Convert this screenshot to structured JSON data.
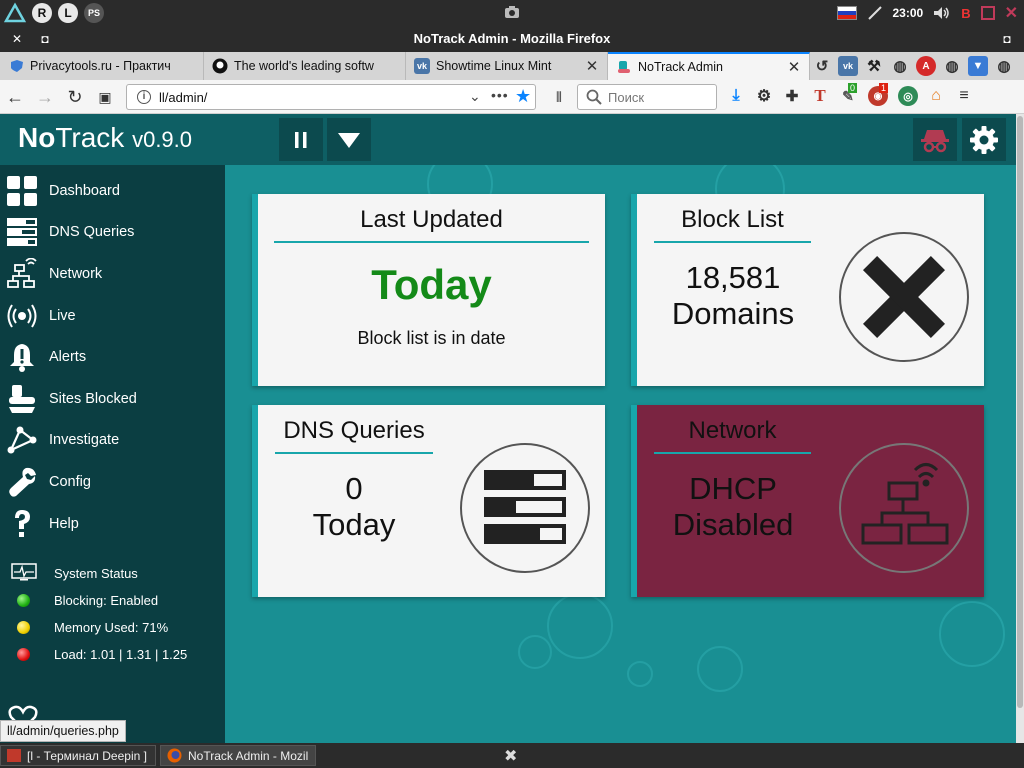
{
  "system_panel": {
    "launcher_letters": [
      "R",
      "L"
    ],
    "clock": "23:00"
  },
  "window": {
    "title": "NoTrack Admin - Mozilla Firefox"
  },
  "tabs": [
    {
      "label": "Privacytools.ru - Практич",
      "icon": "privacytools-shield-icon",
      "active": false
    },
    {
      "label": "The world's leading softw",
      "icon": "github-icon",
      "active": false
    },
    {
      "label": "Showtime Linux Mint",
      "icon": "vk-icon",
      "active": false
    },
    {
      "label": "NoTrack Admin",
      "icon": "notrack-icon",
      "active": true
    }
  ],
  "navbar": {
    "url": "ll/admin/",
    "search_placeholder": "Поиск",
    "badges": {
      "green": "0",
      "red": "1"
    }
  },
  "notrack": {
    "logo_bold": "No",
    "logo_rest": "Track",
    "version": "v0.9.0",
    "sidebar": [
      {
        "label": "Dashboard",
        "icon": "dashboard-icon"
      },
      {
        "label": "DNS Queries",
        "icon": "dns-queries-icon"
      },
      {
        "label": "Network",
        "icon": "network-icon"
      },
      {
        "label": "Live",
        "icon": "live-broadcast-icon"
      },
      {
        "label": "Alerts",
        "icon": "bell-icon"
      },
      {
        "label": "Sites Blocked",
        "icon": "sites-blocked-icon"
      },
      {
        "label": "Investigate",
        "icon": "investigate-icon"
      },
      {
        "label": "Config",
        "icon": "wrench-icon"
      },
      {
        "label": "Help",
        "icon": "question-icon"
      }
    ],
    "status": {
      "title": "System Status",
      "items": [
        {
          "label": "Blocking: Enabled",
          "color": "#1fb012"
        },
        {
          "label": "Memory Used: 71%",
          "color": "#f0d000"
        },
        {
          "label": "Load: 1.01 | 1.31 | 1.25",
          "color": "#e01010"
        }
      ]
    },
    "cards": {
      "last_updated": {
        "title": "Last Updated",
        "value": "Today",
        "subtitle": "Block list is in date"
      },
      "block_list": {
        "title": "Block List",
        "count": "18,581",
        "unit": "Domains"
      },
      "dns_queries": {
        "title": "DNS Queries",
        "count": "0",
        "unit": "Today"
      },
      "network": {
        "title": "Network",
        "line1": "DHCP",
        "line2": "Disabled"
      }
    },
    "colors": {
      "background": "#198f93",
      "sidebar": "#0b3e42",
      "header": "#0e5f64",
      "accent": "#18a6ab",
      "ok_green": "#148a18",
      "network_card": "#7a2441"
    }
  },
  "link_status": "ll/admin/queries.php",
  "taskbar": [
    {
      "label": "[l - Терминал Deepin ]",
      "icon": "terminal-icon"
    },
    {
      "label": "NoTrack Admin - Mozil...",
      "icon": "firefox-icon"
    }
  ]
}
